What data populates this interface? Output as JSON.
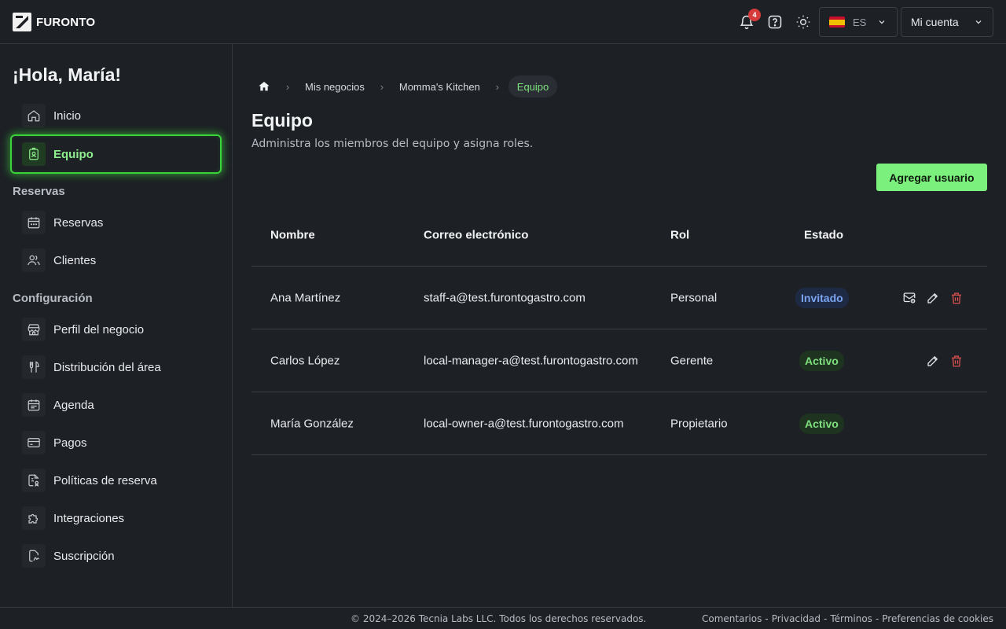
{
  "app": {
    "logo_text": "FURONTO"
  },
  "topbar": {
    "notifications_count": "4",
    "language": {
      "code": "ES",
      "flag": "spain-flag"
    },
    "account_label": "Mi cuenta"
  },
  "sidebar": {
    "greeting": "¡Hola, María!",
    "items_top": [
      {
        "label": "Inicio",
        "icon": "home-icon"
      },
      {
        "label": "Equipo",
        "icon": "team-badge-icon",
        "active": true
      }
    ],
    "section_reservas": "Reservas",
    "items_reservas": [
      {
        "label": "Reservas",
        "icon": "calendar-icon"
      },
      {
        "label": "Clientes",
        "icon": "users-icon"
      }
    ],
    "section_config": "Configuración",
    "items_config": [
      {
        "label": "Perfil del negocio",
        "icon": "store-icon"
      },
      {
        "label": "Distribución del área",
        "icon": "utensils-icon"
      },
      {
        "label": "Agenda",
        "icon": "agenda-icon"
      },
      {
        "label": "Pagos",
        "icon": "card-icon"
      },
      {
        "label": "Políticas de reserva",
        "icon": "policy-icon"
      },
      {
        "label": "Integraciones",
        "icon": "puzzle-icon"
      },
      {
        "label": "Suscripción",
        "icon": "subscription-icon"
      }
    ]
  },
  "breadcrumb": {
    "items": [
      "Mis negocios",
      "Momma's Kitchen"
    ],
    "current": "Equipo"
  },
  "page": {
    "title": "Equipo",
    "subtitle": "Administra los miembros del equipo y asigna roles.",
    "add_button": "Agregar usuario"
  },
  "table": {
    "headers": {
      "name": "Nombre",
      "email": "Correo electrónico",
      "role": "Rol",
      "status": "Estado"
    },
    "rows": [
      {
        "name": "Ana Martínez",
        "email": "staff-a@test.furontogastro.com",
        "role": "Personal",
        "status": "Invitado",
        "status_kind": "invited",
        "actions": [
          "resend-invite-icon",
          "edit-icon",
          "delete-icon"
        ]
      },
      {
        "name": "Carlos López",
        "email": "local-manager-a@test.furontogastro.com",
        "role": "Gerente",
        "status": "Activo",
        "status_kind": "active",
        "actions": [
          "edit-icon",
          "delete-icon"
        ]
      },
      {
        "name": "María González",
        "email": "local-owner-a@test.furontogastro.com",
        "role": "Propietario",
        "status": "Activo",
        "status_kind": "active",
        "actions": []
      }
    ]
  },
  "footer": {
    "copyright": "© 2024–2026 Tecnia Labs LLC. Todos los derechos reservados.",
    "links": [
      "Comentarios",
      "Privacidad",
      "Términos",
      "Preferencias de cookies"
    ],
    "separator": "-"
  },
  "colors": {
    "accent": "#7cf07c",
    "danger": "#e05252",
    "invited": "#7ba4f2",
    "background": "#1d2025"
  }
}
